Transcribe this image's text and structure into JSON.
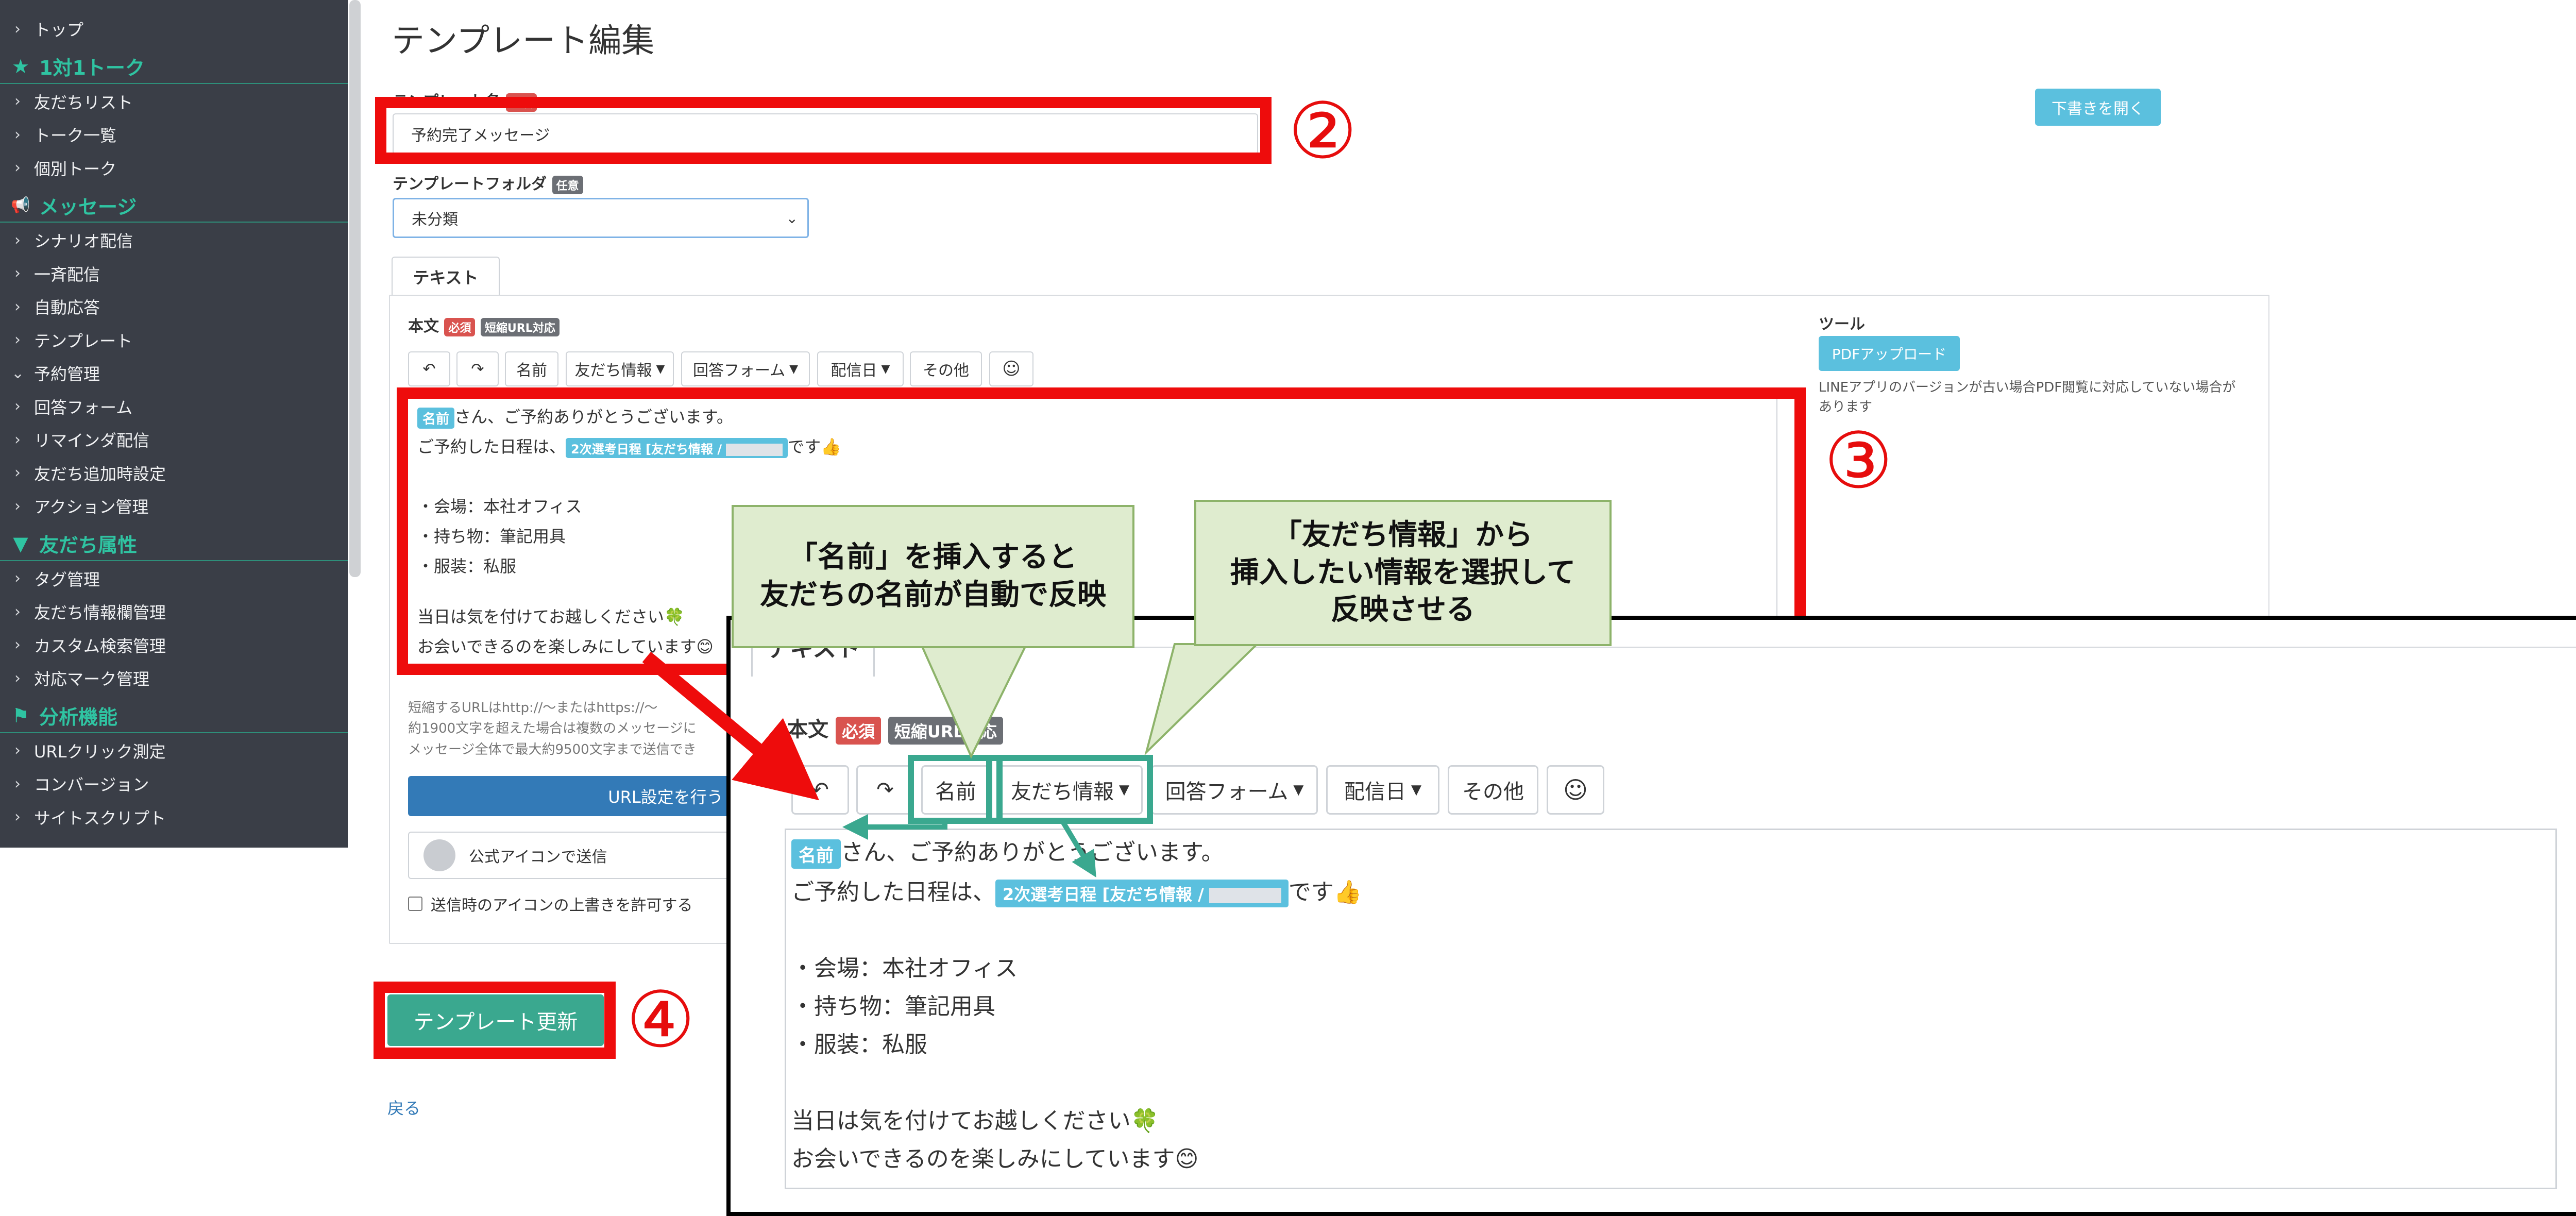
{
  "sidebar": {
    "items": [
      {
        "type": "item",
        "label": "トップ"
      },
      {
        "type": "section",
        "label": "1対1トーク",
        "icon": "star-icon"
      },
      {
        "type": "item",
        "label": "友だちリスト"
      },
      {
        "type": "item",
        "label": "トーク一覧"
      },
      {
        "type": "item",
        "label": "個別トーク"
      },
      {
        "type": "section",
        "label": "メッセージ",
        "icon": "megaphone-icon"
      },
      {
        "type": "item",
        "label": "シナリオ配信"
      },
      {
        "type": "item",
        "label": "一斉配信"
      },
      {
        "type": "item",
        "label": "自動応答"
      },
      {
        "type": "item",
        "label": "テンプレート"
      },
      {
        "type": "item",
        "label": "予約管理",
        "expanded": true
      },
      {
        "type": "item",
        "label": "回答フォーム"
      },
      {
        "type": "item",
        "label": "リマインダ配信"
      },
      {
        "type": "item",
        "label": "友だち追加時設定"
      },
      {
        "type": "item",
        "label": "アクション管理"
      },
      {
        "type": "section",
        "label": "友だち属性",
        "icon": "filter-icon"
      },
      {
        "type": "item",
        "label": "タグ管理"
      },
      {
        "type": "item",
        "label": "友だち情報欄管理"
      },
      {
        "type": "item",
        "label": "カスタム検索管理"
      },
      {
        "type": "item",
        "label": "対応マーク管理"
      },
      {
        "type": "section",
        "label": "分析機能",
        "icon": "flag-icon"
      },
      {
        "type": "item",
        "label": "URLクリック測定"
      },
      {
        "type": "item",
        "label": "コンバージョン"
      },
      {
        "type": "item",
        "label": "サイトスクリプト"
      }
    ]
  },
  "page": {
    "title": "テンプレート編集",
    "template_name_label": "テンプレート名",
    "template_name_value": "予約完了メッセージ",
    "draft_button": "下書きを開く",
    "folder_label": "テンプレートフォルダ",
    "folder_badge": "任意",
    "folder_value": "未分類",
    "tab_text": "テキスト",
    "body_label": "本文",
    "required_badge": "必須",
    "short_url_badge": "短縮URL対応",
    "toolbar": {
      "name": "名前",
      "friend_info": "友だち情報",
      "answer_form": "回答フォーム",
      "delivery_date": "配信日",
      "other": "その他"
    },
    "tool_label": "ツール",
    "pdf_button": "PDFアップロード",
    "pdf_note": "LINEアプリのバージョンが古い場合PDF閲覧に対応していない場合があります",
    "url_note_1": "短縮するURLはhttp://～またはhttps://～",
    "url_note_2": "約1900文字を超えた場合は複数のメッセージに",
    "url_note_3": "メッセージ全体で最大約9500文字まで送信でき",
    "url_button": "URL設定を行う",
    "sender_label": "公式アイコンで送信",
    "override_label": "送信時のアイコンの上書きを許可する",
    "update_button": "テンプレート更新",
    "back_link": "戻る"
  },
  "editor": {
    "name_chip": "名前",
    "line1_rest": "さん、ご予約ありがとうございます。",
    "line2_prefix": "ご予約した日程は、",
    "date_chip": "2次選考日程 [友だち情報 /",
    "line2_suffix": "です",
    "line2_emoji": "👍",
    "line3": "・会場：本社オフィス",
    "line4": "・持ち物：筆記用具",
    "line5": "・服装：私服",
    "line6": "当日は気を付けてお越しください",
    "line6_emoji": "🍀",
    "line7": "お会いできるのを楽しみにしています",
    "line7_emoji": "😊"
  },
  "annotations": {
    "step2": "②",
    "step3": "③",
    "step4": "④",
    "callout_name_1": "「名前」を挿入すると",
    "callout_name_2": "友だちの名前が自動で反映",
    "callout_info_1": "「友だち情報」から",
    "callout_info_2": "挿入したい情報を選択して",
    "callout_info_3": "反映させる"
  },
  "colors": {
    "sidebar_bg": "#3a3e47",
    "sidebar_accent": "#2fc4a2",
    "highlight_red": "#ee0c0c",
    "highlight_teal": "#3aa88f",
    "primary_blue": "#337ab7",
    "info_blue": "#5bc0de",
    "update_green": "#3aa88f",
    "callout_fill": "#dfeccf"
  }
}
